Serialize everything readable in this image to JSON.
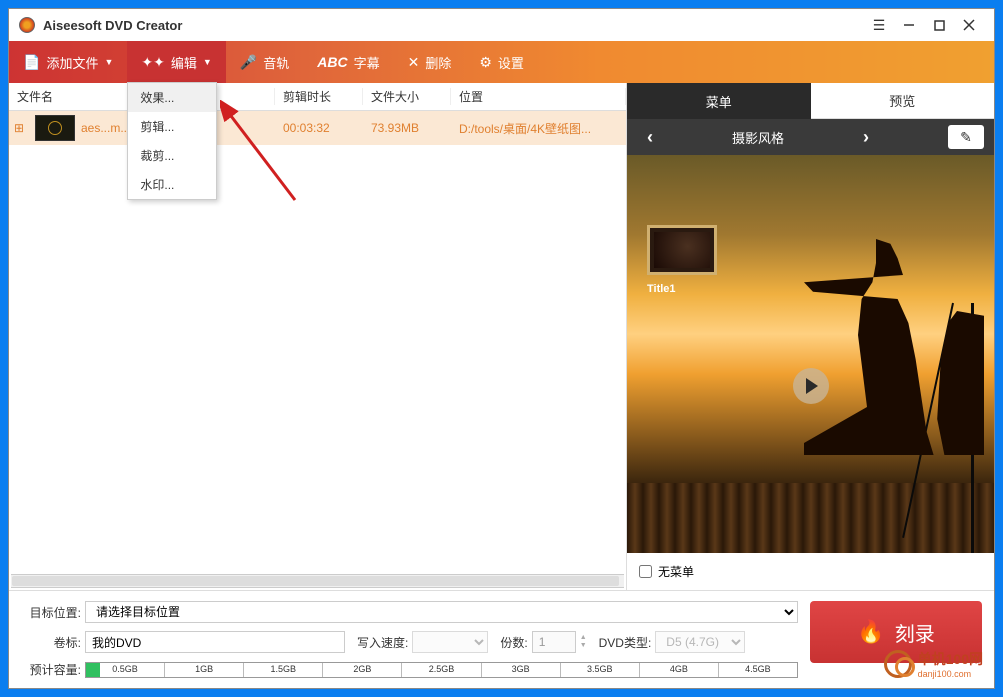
{
  "title": "Aiseesoft DVD Creator",
  "toolbar": {
    "add": "添加文件",
    "edit": "编辑",
    "audio": "音轨",
    "subtitle": "字幕",
    "subtitle_icon": "ABC",
    "delete": "删除",
    "settings": "设置"
  },
  "edit_menu": {
    "effect": "效果...",
    "clip": "剪辑...",
    "crop": "裁剪...",
    "watermark": "水印..."
  },
  "columns": {
    "name": "文件名",
    "duration": "剪辑时长",
    "size": "文件大小",
    "location": "位置"
  },
  "file": {
    "name": "aes...m...",
    "duration": "00:03:32",
    "size": "73.93MB",
    "location": "D:/tools/桌面/4K壁纸图..."
  },
  "right_panel": {
    "tab_menu": "菜单",
    "tab_preview": "预览",
    "style_name": "摄影风格",
    "title_label": "Title1",
    "no_menu": "无菜单"
  },
  "bottom": {
    "dest_label": "目标位置:",
    "dest_placeholder": "请选择目标位置",
    "volume_label": "卷标:",
    "volume_value": "我的DVD",
    "write_speed_label": "写入速度:",
    "copies_label": "份数:",
    "copies_value": "1",
    "dvd_type_label": "DVD类型:",
    "dvd_type_value": "D5 (4.7G)",
    "capacity_label": "预计容量:",
    "ticks": [
      "0.5GB",
      "1GB",
      "1.5GB",
      "2GB",
      "2.5GB",
      "3GB",
      "3.5GB",
      "4GB",
      "4.5GB"
    ],
    "burn": "刻录"
  },
  "watermark_site": {
    "name": "单机100网",
    "url": "danji100.com"
  }
}
